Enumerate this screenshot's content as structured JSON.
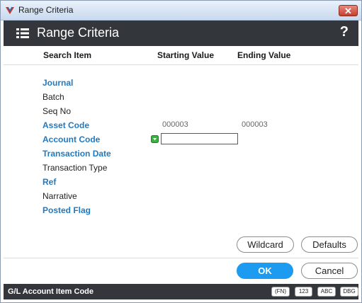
{
  "window": {
    "title": "Range Criteria"
  },
  "header": {
    "title": "Range Criteria",
    "help": "?"
  },
  "columns": {
    "search_item": "Search Item",
    "starting_value": "Starting Value",
    "ending_value": "Ending Value"
  },
  "rows": [
    {
      "label": "Journal",
      "link": true
    },
    {
      "label": "Batch",
      "link": false
    },
    {
      "label": "Seq No",
      "link": false
    },
    {
      "label": "Asset Code",
      "link": true,
      "start": "000003",
      "end": "000003"
    },
    {
      "label": "Account Code",
      "link": true,
      "input_value": ""
    },
    {
      "label": "Transaction Date",
      "link": true
    },
    {
      "label": "Transaction Type",
      "link": false
    },
    {
      "label": "Ref",
      "link": true
    },
    {
      "label": "Narrative",
      "link": false
    },
    {
      "label": "Posted Flag",
      "link": true
    }
  ],
  "buttons": {
    "wildcard": "Wildcard",
    "defaults": "Defaults",
    "ok": "OK",
    "cancel": "Cancel"
  },
  "status": {
    "text": "G/L Account Item Code",
    "keys": [
      "(FN)",
      "123",
      "ABC",
      "DBG"
    ]
  },
  "colors": {
    "link": "#1f7ac2",
    "header_bg": "#33373b",
    "ok_button": "#1d9bf0"
  }
}
